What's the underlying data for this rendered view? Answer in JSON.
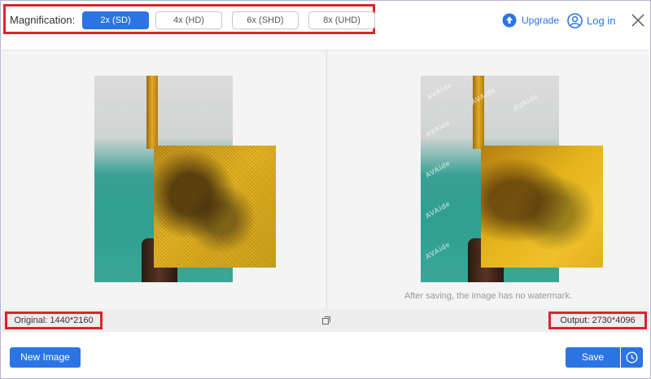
{
  "magnification": {
    "label": "Magnification:",
    "options": [
      "2x (SD)",
      "4x (HD)",
      "6x (SHD)",
      "8x (UHD)"
    ],
    "selected": "2x (SD)"
  },
  "header": {
    "upgrade_label": "Upgrade",
    "login_label": "Log in"
  },
  "preview": {
    "watermark_text": "AVAide",
    "note": "After saving, the image has no watermark."
  },
  "info": {
    "original": "Original: 1440*2160",
    "output": "Output: 2730*4096"
  },
  "footer": {
    "new_image_label": "New Image",
    "save_label": "Save"
  },
  "colors": {
    "accent": "#2b74e4",
    "highlight_border": "#d9252b"
  },
  "icons": [
    "upgrade-icon",
    "user-icon",
    "close-icon",
    "compare-icon",
    "clock-icon"
  ]
}
